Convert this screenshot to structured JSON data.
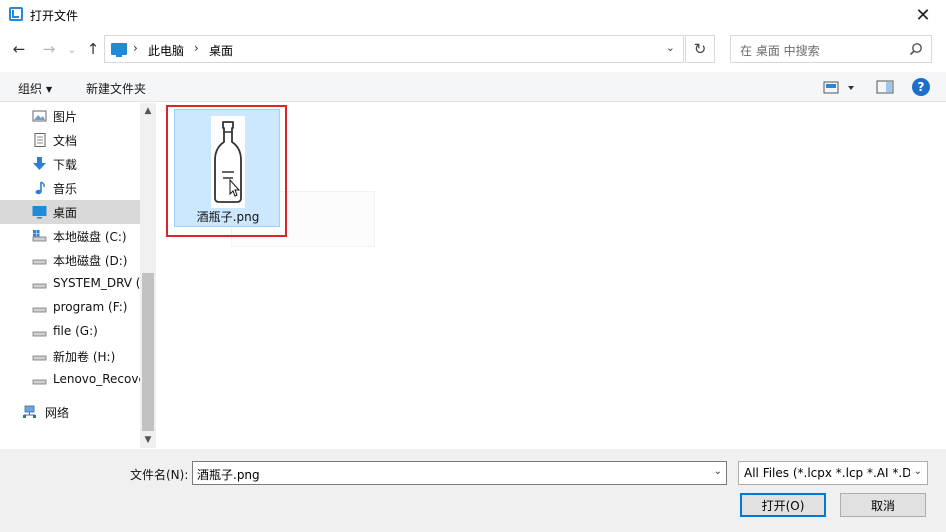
{
  "window": {
    "title": "打开文件",
    "close_glyph": "✕"
  },
  "nav": {
    "back_glyph": "←",
    "forward_glyph": "→",
    "recent_glyph": "⌄",
    "up_glyph": "↑"
  },
  "address": {
    "breadcrumbs": [
      "此电脑",
      "桌面"
    ],
    "separator": "›",
    "dropdown_glyph": "⌄",
    "refresh_glyph": "↻"
  },
  "search": {
    "placeholder": "在 桌面 中搜索"
  },
  "toolbar": {
    "organize": "组织",
    "new_folder": "新建文件夹",
    "help": "?"
  },
  "sidebar": {
    "items": [
      {
        "label": "图片",
        "icon": "pictures-icon"
      },
      {
        "label": "文档",
        "icon": "documents-icon"
      },
      {
        "label": "下载",
        "icon": "download-icon"
      },
      {
        "label": "音乐",
        "icon": "music-icon"
      },
      {
        "label": "桌面",
        "icon": "desktop-icon",
        "selected": true
      },
      {
        "label": "本地磁盘 (C:)",
        "icon": "drive-system-icon"
      },
      {
        "label": "本地磁盘 (D:)",
        "icon": "drive-icon"
      },
      {
        "label": "SYSTEM_DRV (",
        "icon": "drive-icon"
      },
      {
        "label": "program (F:)",
        "icon": "drive-icon"
      },
      {
        "label": "file (G:)",
        "icon": "drive-icon"
      },
      {
        "label": "新加卷 (H:)",
        "icon": "drive-icon"
      },
      {
        "label": "Lenovo_Recove",
        "icon": "drive-icon"
      },
      {
        "label": "网络",
        "icon": "network-icon"
      }
    ]
  },
  "files": [
    {
      "name": "酒瓶子.png",
      "selected": true
    }
  ],
  "bottom": {
    "filename_label": "文件名(N):",
    "filename_value": "酒瓶子.png",
    "filetype_value": "All Files (*.lcpx *.lcp *.AI *.DX",
    "open_button": "打开(O)",
    "cancel_button": "取消"
  },
  "colors": {
    "selection": "#cce8ff",
    "accent": "#0078d7",
    "highlight": "#d6272a",
    "help": "#1e6fc8"
  }
}
